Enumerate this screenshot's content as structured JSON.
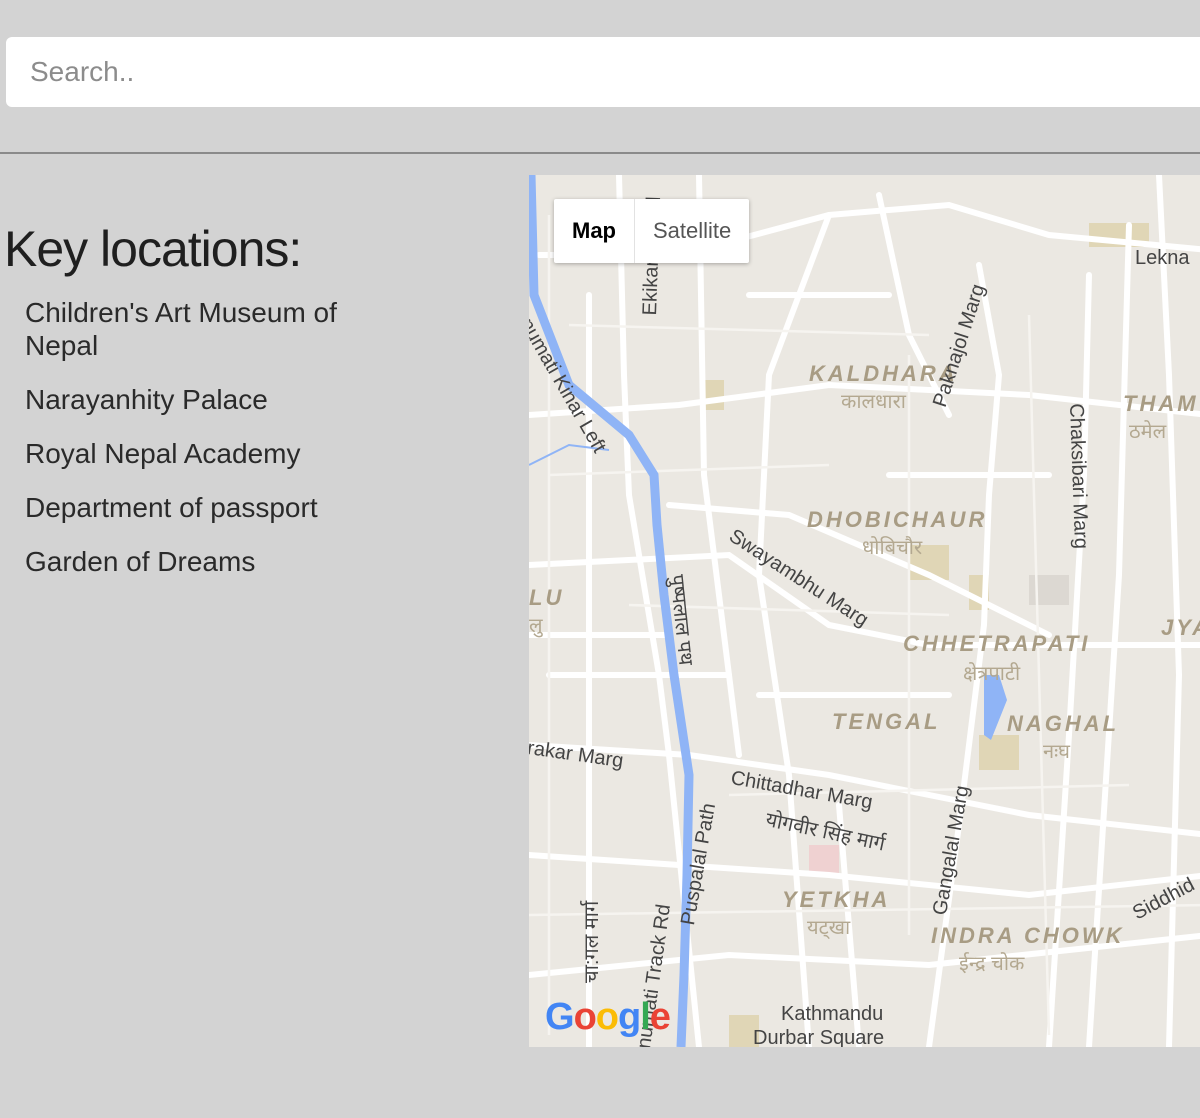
{
  "search": {
    "placeholder": "Search.."
  },
  "sidebar": {
    "heading": "Key locations:",
    "locations": [
      "Children's Art Museum of Nepal",
      "Narayanhity Palace",
      "Royal Nepal Academy",
      "Department of passport",
      "Garden of Dreams"
    ]
  },
  "map": {
    "type_controls": {
      "map": "Map",
      "satellite": "Satellite"
    },
    "areas": [
      {
        "name": "KALDHARA",
        "local": "कालधारा"
      },
      {
        "name": "DHOBICHAUR",
        "local": "धोबिचौर"
      },
      {
        "name": "CHHETRAPATI",
        "local": "क्षेत्रपाटी"
      },
      {
        "name": "TENGAL"
      },
      {
        "name": "NAGHAL",
        "local": "नःघ"
      },
      {
        "name": "YETKHA",
        "local": "यट्खा"
      },
      {
        "name": "INDRA CHOWK",
        "local": "ईन्द्र चोक"
      },
      {
        "name": "THAM",
        "local": "ठमेल"
      },
      {
        "name": "LU",
        "local": "लु"
      },
      {
        "name": "JYA"
      }
    ],
    "roads": [
      "Lekna",
      "Ekikaran Sad",
      "Paknajol Marg",
      "Chaksibari Marg",
      "hnumati Kinar Left",
      "Swayambhu Marg",
      "पुष्पलाल पथ",
      "rakar Marg",
      "Chittadhar Marg",
      "योगवीर सिंह मार्ग",
      "Gangalal Marg",
      "numati Track Rd",
      "Puspalal Path",
      "चा:गल मार्ग",
      "Siddhid",
      "Kathmandu",
      "Durbar Square"
    ],
    "logo": [
      "G",
      "o",
      "o",
      "g",
      "l",
      "e"
    ],
    "colors": {
      "river": "#8fb4f6",
      "land": "#ebe8e2",
      "road": "#ffffff"
    }
  }
}
